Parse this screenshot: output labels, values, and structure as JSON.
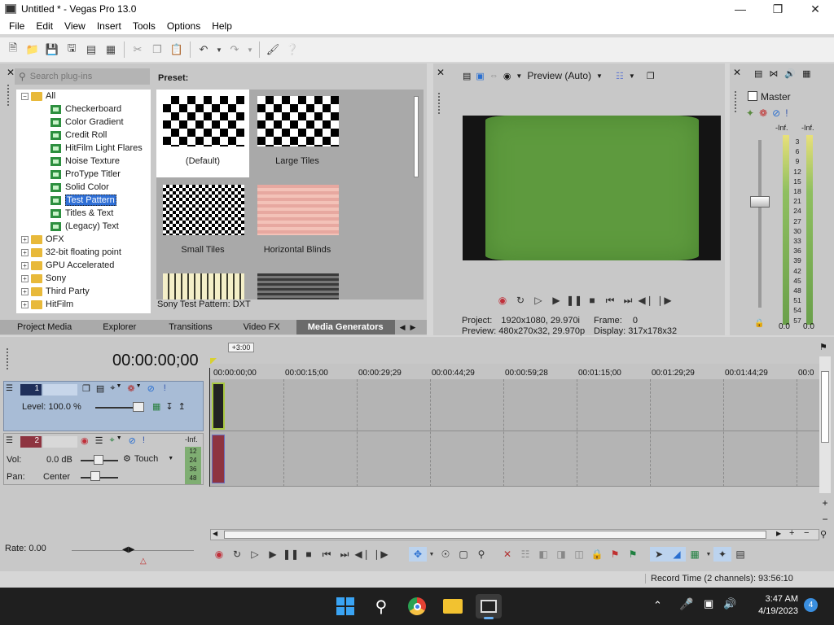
{
  "window": {
    "title": "Untitled * - Vegas Pro 13.0"
  },
  "menu": [
    "File",
    "Edit",
    "View",
    "Insert",
    "Tools",
    "Options",
    "Help"
  ],
  "explorer": {
    "search_placeholder": "Search plug-ins",
    "preset_label": "Preset:",
    "tree": [
      {
        "label": "All",
        "type": "folder",
        "expanded": true
      },
      {
        "label": "Checkerboard",
        "type": "fx"
      },
      {
        "label": "Color Gradient",
        "type": "fx"
      },
      {
        "label": "Credit Roll",
        "type": "fx"
      },
      {
        "label": "HitFilm Light Flares",
        "type": "fx"
      },
      {
        "label": "Noise Texture",
        "type": "fx"
      },
      {
        "label": "ProType Titler",
        "type": "fx"
      },
      {
        "label": "Solid Color",
        "type": "fx"
      },
      {
        "label": "Test Pattern",
        "type": "fx",
        "selected": true
      },
      {
        "label": "Titles & Text",
        "type": "fx"
      },
      {
        "label": "(Legacy) Text",
        "type": "fx"
      },
      {
        "label": "OFX",
        "type": "folder"
      },
      {
        "label": "32-bit floating point",
        "type": "folder"
      },
      {
        "label": "GPU Accelerated",
        "type": "folder"
      },
      {
        "label": "Sony",
        "type": "folder"
      },
      {
        "label": "Third Party",
        "type": "folder"
      },
      {
        "label": "HitFilm",
        "type": "folder"
      }
    ],
    "presets": [
      "(Default)",
      "Large Tiles",
      "Small Tiles",
      "Horizontal Blinds"
    ],
    "status": "Sony Test Pattern: DXT",
    "tabs": [
      "Project Media",
      "Explorer",
      "Transitions",
      "Video FX",
      "Media Generators"
    ]
  },
  "preview": {
    "mode": "Preview (Auto)",
    "project_label": "Project:",
    "project_value": "1920x1080, 29.970i",
    "preview_label": "Preview:",
    "preview_value": "480x270x32, 29.970p",
    "frame_label": "Frame:",
    "frame_value": "0",
    "display_label": "Display:",
    "display_value": "317x178x32"
  },
  "master": {
    "title": "Master",
    "inf_left": "-Inf.",
    "inf_right": "-Inf.",
    "scale": [
      "3",
      "6",
      "9",
      "12",
      "15",
      "18",
      "21",
      "24",
      "27",
      "30",
      "33",
      "36",
      "39",
      "42",
      "45",
      "48",
      "51",
      "54",
      "57"
    ],
    "bottom_left": "0.0",
    "bottom_right": "0.0"
  },
  "timeline": {
    "timecode": "00:00:00;00",
    "offset": "+3:00",
    "ruler": [
      "00:00:00;00",
      "00:00:15;00",
      "00:00:29;29",
      "00:00:44;29",
      "00:00:59;28",
      "00:01:15;00",
      "00:01:29;29",
      "00:01:44;29",
      "00:0"
    ],
    "video_track": {
      "number": "1",
      "level_label": "Level:",
      "level_value": "100.0 %"
    },
    "audio_track": {
      "number": "2",
      "vol_label": "Vol:",
      "vol_value": "0.0 dB",
      "pan_label": "Pan:",
      "pan_value": "Center",
      "automation": "Touch",
      "inf": "-Inf.",
      "meter_scale": [
        "12",
        "24",
        "36",
        "48"
      ]
    },
    "rate": "Rate: 0.00"
  },
  "status_bar": {
    "record_time": "Record Time (2 channels): 93:56:10"
  },
  "taskbar": {
    "time": "3:47 AM",
    "date": "4/19/2023",
    "notification_count": "4"
  },
  "colors": {
    "selection": "#2f6fd6",
    "preview_green": "#5e9a3e",
    "audio_track": "#8e3440",
    "video_track": "#a8bcd6"
  }
}
